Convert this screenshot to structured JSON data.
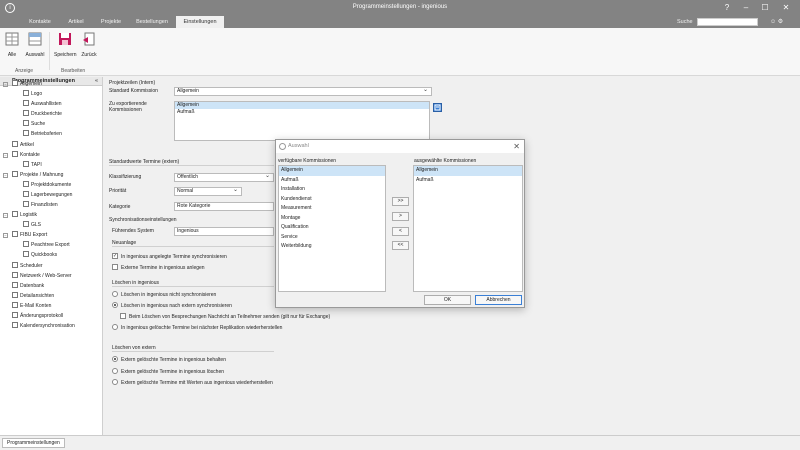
{
  "window": {
    "title": "Programmeinstellungen - ingenious",
    "app_icon": "i",
    "controls": {
      "help": "?",
      "minimize": "–",
      "maximize": "☐",
      "close": "✕"
    }
  },
  "menu": {
    "tabs": [
      "Kontakte",
      "Artikel",
      "Projekte",
      "Bestellungen",
      "Einstellungen"
    ],
    "active_tab": "Einstellungen",
    "search_label": "Suche",
    "search_value": "",
    "icons": "☺ ⚙"
  },
  "ribbon": {
    "buttons": {
      "alle": "Alle",
      "auswahl": "Auswahl",
      "speichern": "Speichern",
      "zurueck": "Zurück"
    },
    "groups": {
      "anzeige": "Anzeige",
      "bearbeiten": "Bearbeiten"
    }
  },
  "sidebar": {
    "header": "Programmeinstellungen",
    "collapse": "«",
    "items": [
      {
        "label": "Allgemein",
        "level": 0,
        "exp": "−"
      },
      {
        "label": "Logo",
        "level": 1
      },
      {
        "label": "Auswahllisten",
        "level": 1
      },
      {
        "label": "Druckberichte",
        "level": 1
      },
      {
        "label": "Suche",
        "level": 1
      },
      {
        "label": "Betriebsferien",
        "level": 1
      },
      {
        "label": "Artikel",
        "level": 0
      },
      {
        "label": "Kontakte",
        "level": 0,
        "exp": "−"
      },
      {
        "label": "TAPI",
        "level": 1
      },
      {
        "label": "Projekte / Mahnung",
        "level": 0,
        "exp": "−"
      },
      {
        "label": "Projektdokumente",
        "level": 1
      },
      {
        "label": "Lagerbewegungen",
        "level": 1
      },
      {
        "label": "Finanzlisten",
        "level": 1
      },
      {
        "label": "Logistik",
        "level": 0,
        "exp": "−"
      },
      {
        "label": "GLS",
        "level": 1
      },
      {
        "label": "FIBU Export",
        "level": 0,
        "exp": "−"
      },
      {
        "label": "Peachtree Export",
        "level": 1
      },
      {
        "label": "Quickbooks",
        "level": 1
      },
      {
        "label": "Scheduler",
        "level": 0
      },
      {
        "label": "Netzwerk / Web-Server",
        "level": 0
      },
      {
        "label": "Datenbank",
        "level": 0
      },
      {
        "label": "Detailansichten",
        "level": 0
      },
      {
        "label": "E-Mail Konten",
        "level": 0
      },
      {
        "label": "Änderungsprotokoll",
        "level": 0
      },
      {
        "label": "Kalendersynchronisation",
        "level": 0
      }
    ]
  },
  "main": {
    "projektzeilen_header": "Projektzeilen (Intern)",
    "standard_kommission_label": "Standard Kommission",
    "standard_kommission_value": "Allgemein",
    "zu_exportierende_label": "Zu exportierende\nKommissionen",
    "export_list": [
      "Allgemein",
      "Aufmaß"
    ],
    "standardwerte_header": "Standardwerte Termine (extern)",
    "klassifizierung_label": "Klassifizierung",
    "klassifizierung_value": "Öffentlich",
    "prioritaet_label": "Priorität",
    "prioritaet_value": "Normal",
    "kategorie_label": "Kategorie",
    "kategorie_value": "Rote Kategorie",
    "sync_header": "Synchronisationseinstellungen",
    "fuehrendes_label": "Führendes System",
    "fuehrendes_value": "Ingenious",
    "neuanlage_header": "Neuanlage",
    "neuanlage_opt1": "In ingenious angelegte Termine synchronisieren",
    "neuanlage_opt2": "Externe Termine in ingenious anlegen",
    "loeschen_header": "Löschen in ingenious",
    "loeschen_opt1": "Löschen in ingenious nicht synchronisieren",
    "loeschen_opt2": "Löschen in ingenious nach extern synchronisieren",
    "loeschen_sub": "Beim Löschen von Besprechungen Nachricht an Teilnehmer senden (gilt nur für Exchange)",
    "loeschen_opt3": "In ingenious gelöschte Termine bei nächster Replikation wiederherstellen",
    "extern_header": "Löschen von extern",
    "extern_opt1": "Extern gelöschte Termine in ingenious behalten",
    "extern_opt2": "Extern gelöschte Termine in ingenious löschen",
    "extern_opt3": "Extern gelöschte Termine mit Werten aus ingenious wiederherstellen"
  },
  "dialog": {
    "title": "Auswahl",
    "close": "✕",
    "available_label": "verfügbare Kommissionen",
    "selected_label": "ausgewählte Kommissionen",
    "available": [
      "Allgemein",
      "Aufmaß",
      "Installation",
      "Kundendienst",
      "Measurement",
      "Montage",
      "Qualification",
      "Service",
      "Weiterbildung"
    ],
    "selected": [
      "Allgemein",
      "Aufmaß"
    ],
    "btn_all_right": ">>",
    "btn_right": ">",
    "btn_left": "<",
    "btn_all_left": "<<",
    "ok": "OK",
    "cancel": "Abbrechen"
  },
  "statusbar": {
    "tab": "Programmeinstellungen"
  },
  "colors": {
    "titlebar": "#838383",
    "selection": "#cde4f7",
    "focus_blue": "#3a7fd5"
  }
}
